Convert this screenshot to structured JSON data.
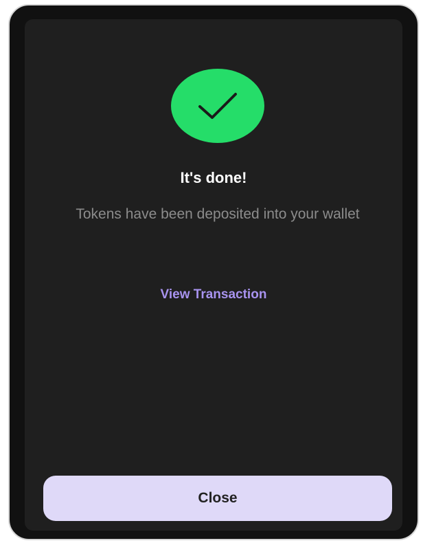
{
  "dialog": {
    "status_icon": "checkmark-icon",
    "title": "It's done!",
    "message": "Tokens have been deposited into your wallet",
    "link_label": "View Transaction",
    "close_label": "Close"
  },
  "colors": {
    "success": "#25dd69",
    "link": "#a893ef",
    "button_bg": "#dfd9f8",
    "modal_bg": "#1f1f1f"
  }
}
